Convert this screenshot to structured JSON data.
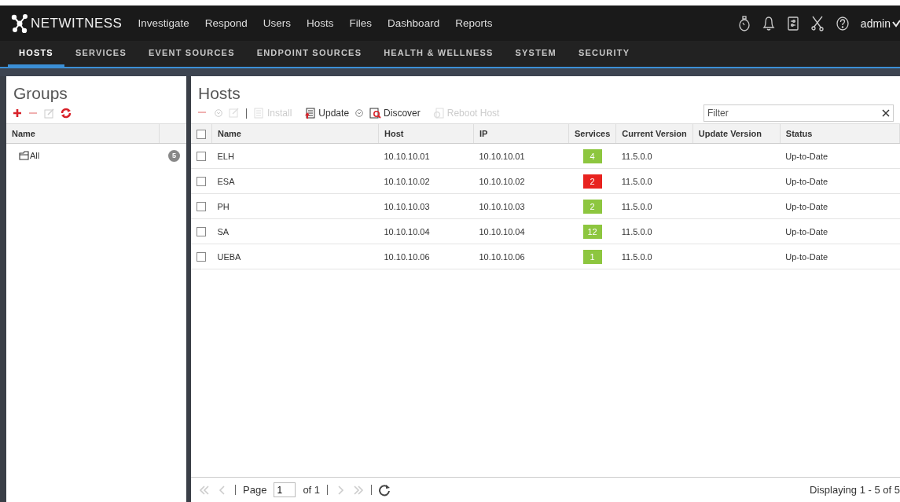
{
  "brand": "NETWITNESS",
  "nav": [
    "Investigate",
    "Respond",
    "Users",
    "Hosts",
    "Files",
    "Dashboard",
    "Reports"
  ],
  "user": "admin",
  "subnav": [
    {
      "label": "HOSTS",
      "selected": true
    },
    {
      "label": "SERVICES",
      "selected": false
    },
    {
      "label": "EVENT SOURCES",
      "selected": false
    },
    {
      "label": "ENDPOINT SOURCES",
      "selected": false
    },
    {
      "label": "HEALTH & WELLNESS",
      "selected": false
    },
    {
      "label": "SYSTEM",
      "selected": false
    },
    {
      "label": "SECURITY",
      "selected": false
    }
  ],
  "groups": {
    "title": "Groups",
    "columns": [
      "Name"
    ],
    "items": [
      {
        "name": "All",
        "count": "5"
      }
    ]
  },
  "hosts": {
    "title": "Hosts",
    "toolbar": [
      {
        "kind": "remove",
        "disabled": true
      },
      {
        "kind": "edit",
        "disabled": true
      },
      {
        "kind": "install",
        "label": "Install",
        "disabled": true
      },
      {
        "kind": "update",
        "label": "Update",
        "disabled": false
      },
      {
        "kind": "discover",
        "label": "Discover",
        "disabled": false
      },
      {
        "kind": "reboot",
        "label": "Reboot Host",
        "disabled": true
      }
    ],
    "filter": {
      "placeholder": "Filter"
    },
    "select_all_checked": false,
    "columns": [
      "Name",
      "Host",
      "IP",
      "Services",
      "Current Version",
      "Update Version",
      "Status"
    ],
    "rows": [
      {
        "checked": false,
        "name": "ELH",
        "host": "10.10.10.01",
        "ip": "10.10.10.01",
        "services": "4",
        "color": "#8dc63f",
        "current_version": "11.5.0.0",
        "status": "Up-to-Date"
      },
      {
        "checked": false,
        "name": "ESA",
        "host": "10.10.10.02",
        "ip": "10.10.10.02",
        "services": "2",
        "color": "#e8231f",
        "current_version": "11.5.0.0",
        "status": "Up-to-Date"
      },
      {
        "checked": false,
        "name": "PH",
        "host": "10.10.10.03",
        "ip": "10.10.10.03",
        "services": "2",
        "color": "#8dc63f",
        "current_version": "11.5.0.0",
        "status": "Up-to-Date"
      },
      {
        "checked": false,
        "name": "SA",
        "host": "10.10.10.04",
        "ip": "10.10.10.04",
        "services": "12",
        "color": "#8dc63f",
        "current_version": "11.5.0.0",
        "status": "Up-to-Date"
      },
      {
        "checked": false,
        "name": "UEBA",
        "host": "10.10.10.06",
        "ip": "10.10.10.06",
        "services": "1",
        "color": "#8dc63f",
        "current_version": "11.5.0.0",
        "status": "Up-to-Date"
      }
    ],
    "pager": {
      "page_label": "Page",
      "page": "1",
      "of": "of 1",
      "display": "Displaying 1 - 5 of 5",
      "first_disabled": true,
      "last_disabled": true
    }
  }
}
